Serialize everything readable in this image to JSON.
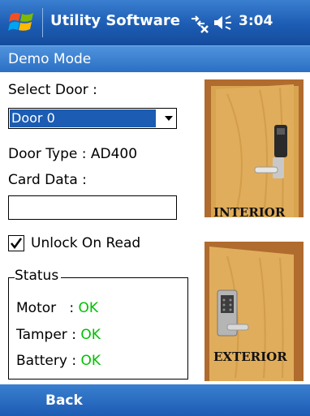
{
  "titlebar": {
    "app_title": "Utility Software",
    "time": "3:04",
    "icons": [
      "windows-start-icon",
      "connectivity-icon",
      "volume-icon"
    ]
  },
  "modebar": {
    "title": "Demo Mode"
  },
  "form": {
    "select_door_label": "Select Door :",
    "door_selected": "Door 0",
    "door_type_label": "Door Type : AD400",
    "card_data_label": "Card Data :",
    "card_data_value": "",
    "unlock_on_read_label": "Unlock On Read",
    "unlock_on_read_checked": true
  },
  "status": {
    "legend": "Status",
    "rows": [
      {
        "label": "Motor   : ",
        "value": "OK"
      },
      {
        "label": "Tamper : ",
        "value": "OK"
      },
      {
        "label": "Battery : ",
        "value": "OK"
      }
    ],
    "ok_color": "#00c000"
  },
  "images": {
    "interior_caption": "INTERIOR",
    "exterior_caption": "EXTERIOR"
  },
  "softkeys": {
    "left": "Back"
  },
  "colors": {
    "titlebar": "#1c5cb3",
    "selection": "#1c5cb3",
    "door_wood": "#d29a3a"
  }
}
